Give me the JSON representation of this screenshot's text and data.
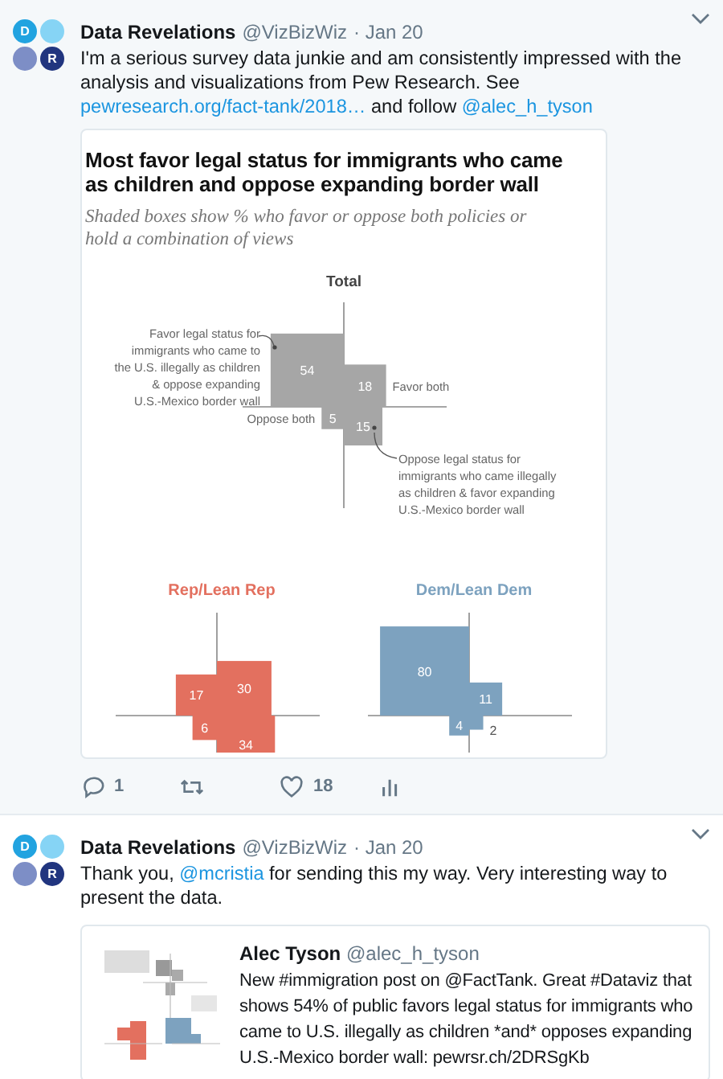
{
  "tweets": [
    {
      "avatar": {
        "circles": [
          {
            "color": "#22a3e0",
            "letter": "D"
          },
          {
            "color": "#86d4f5"
          },
          {
            "color": "#7d8ec6"
          },
          {
            "color": "#21357f",
            "letter": "R"
          }
        ]
      },
      "author": "Data Revelations",
      "handle": "@VizBizWiz",
      "date": "· Jan 20",
      "text": [
        {
          "kind": "plain",
          "text": "I'm a serious survey data junkie and am consistently impressed with the analysis and visualizations from Pew Research. See "
        },
        {
          "kind": "link",
          "text": "pewresearch.org/fact-tank/2018…"
        },
        {
          "kind": "plain",
          "text": " and follow "
        },
        {
          "kind": "link",
          "text": "@alec_h_tyson"
        }
      ],
      "media": {
        "title": "Most favor legal status for immigrants who came as children and oppose expanding border wall",
        "subtitle": "Shaded boxes show % who favor or oppose both policies or hold a combination of views",
        "panels": [
          {
            "title": "Total",
            "kind": "overall",
            "color": "#a6a6a6",
            "boxes": [
              {
                "value": "54",
                "kind": "top_left",
                "label_outside": false,
                "annotation": [
                  "Favor legal status for",
                  "immigrants who came to",
                  "the U.S. illegally as children",
                  "& oppose expanding",
                  "U.S.-Mexico border wall"
                ]
              },
              {
                "value": "18",
                "kind": "top_right",
                "label_outside": false,
                "annotation": [
                  "Favor both"
                ]
              },
              {
                "value": "5",
                "kind": "bottom_left",
                "label_outside": false,
                "annotation": [
                  "Oppose both"
                ]
              },
              {
                "value": "15",
                "kind": "bottom_right",
                "label_outside": false,
                "annotation": [
                  "Oppose legal status for",
                  "immigrants who came illegally",
                  "as children & favor expanding",
                  "U.S.-Mexico border wall"
                ]
              }
            ]
          },
          {
            "title": "Rep/Lean Rep",
            "kind": "party",
            "color": "#e3705f",
            "boxes": [
              {
                "value": "17",
                "kind": "top_left",
                "label_outside": false
              },
              {
                "value": "30",
                "kind": "top_right",
                "label_outside": false
              },
              {
                "value": "6",
                "kind": "bottom_left",
                "label_outside": false
              },
              {
                "value": "34",
                "kind": "bottom_right",
                "label_outside": false
              }
            ]
          },
          {
            "title": "Dem/Lean Dem",
            "kind": "party",
            "color": "#7da2bf",
            "boxes": [
              {
                "value": "80",
                "kind": "top_left",
                "label_outside": false
              },
              {
                "value": "11",
                "kind": "top_right",
                "label_outside": false
              },
              {
                "value": "4",
                "kind": "bottom_left",
                "label_outside": false
              },
              {
                "value": "2",
                "kind": "bottom_right",
                "label_outside": true
              }
            ]
          }
        ]
      },
      "actions": [
        {
          "kind": "reply",
          "count": "1"
        },
        {
          "kind": "retweet"
        },
        {
          "kind": "like",
          "count": "18"
        },
        {
          "kind": "analytics"
        }
      ]
    },
    {
      "avatar": {
        "circles": [
          {
            "color": "#22a3e0",
            "letter": "D"
          },
          {
            "color": "#86d4f5"
          },
          {
            "color": "#7d8ec6"
          },
          {
            "color": "#21357f",
            "letter": "R"
          }
        ]
      },
      "author": "Data Revelations",
      "handle": "@VizBizWiz",
      "date": "· Jan 20",
      "text": [
        {
          "kind": "plain",
          "text": "Thank you, "
        },
        {
          "kind": "link",
          "text": "@mcristia"
        },
        {
          "kind": "plain",
          "text": " for sending this my way. Very interesting way to present the data."
        }
      ],
      "quote": {
        "author": "Alec Tyson",
        "handle": "@alec_h_tyson",
        "text": "New #immigration post on @FactTank. Great #Dataviz that shows 54% of public favors legal status for immigrants who came to U.S. illegally as children *and* opposes expanding U.S.-Mexico border wall: pewrsr.ch/2DRSgKb"
      }
    }
  ]
}
